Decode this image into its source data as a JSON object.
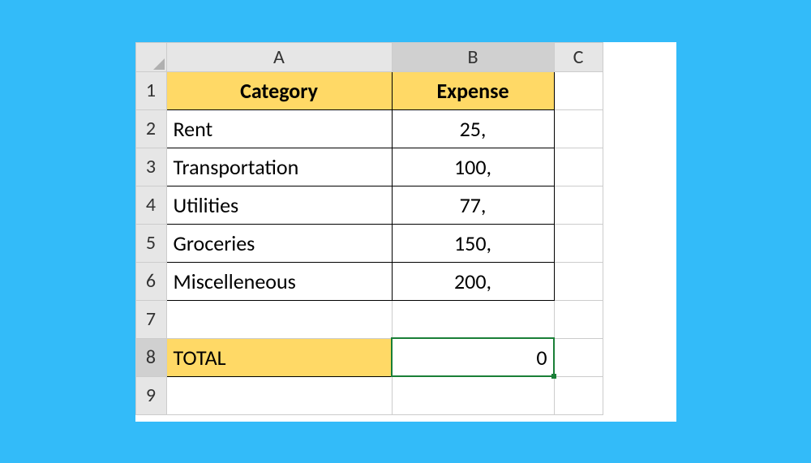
{
  "columns": [
    "A",
    "B",
    "C"
  ],
  "rows": [
    "1",
    "2",
    "3",
    "4",
    "5",
    "6",
    "7",
    "8",
    "9"
  ],
  "header": {
    "A": "Category",
    "B": "Expense"
  },
  "data": [
    {
      "cat": "Rent",
      "exp": "25,"
    },
    {
      "cat": "Transportation",
      "exp": "100,"
    },
    {
      "cat": "Utilities",
      "exp": "77,"
    },
    {
      "cat": "Groceries",
      "exp": "150,"
    },
    {
      "cat": "Miscelleneous",
      "exp": "200,"
    }
  ],
  "total": {
    "label": "TOTAL",
    "value": "0"
  },
  "selected_cell": "B8"
}
